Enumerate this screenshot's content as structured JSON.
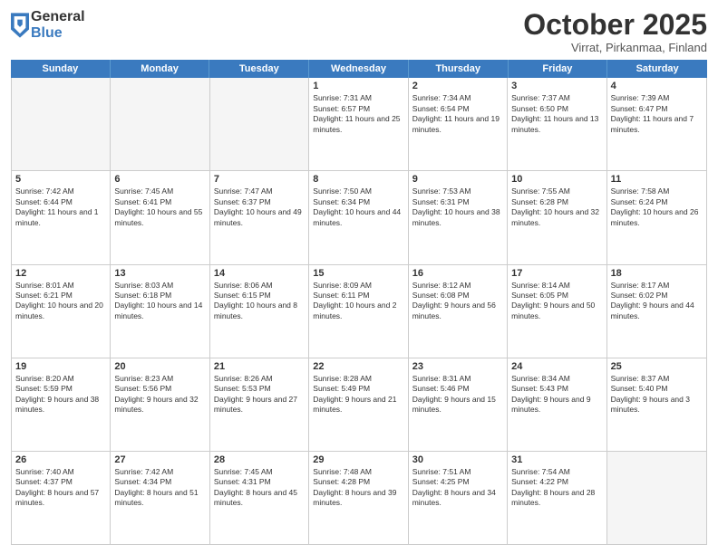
{
  "header": {
    "logo_general": "General",
    "logo_blue": "Blue",
    "month": "October 2025",
    "location": "Virrat, Pirkanmaa, Finland"
  },
  "days_of_week": [
    "Sunday",
    "Monday",
    "Tuesday",
    "Wednesday",
    "Thursday",
    "Friday",
    "Saturday"
  ],
  "weeks": [
    [
      {
        "day": "",
        "empty": true
      },
      {
        "day": "",
        "empty": true
      },
      {
        "day": "",
        "empty": true
      },
      {
        "day": "1",
        "sunrise": "7:31 AM",
        "sunset": "6:57 PM",
        "daylight": "11 hours and 25 minutes."
      },
      {
        "day": "2",
        "sunrise": "7:34 AM",
        "sunset": "6:54 PM",
        "daylight": "11 hours and 19 minutes."
      },
      {
        "day": "3",
        "sunrise": "7:37 AM",
        "sunset": "6:50 PM",
        "daylight": "11 hours and 13 minutes."
      },
      {
        "day": "4",
        "sunrise": "7:39 AM",
        "sunset": "6:47 PM",
        "daylight": "11 hours and 7 minutes."
      }
    ],
    [
      {
        "day": "5",
        "sunrise": "7:42 AM",
        "sunset": "6:44 PM",
        "daylight": "11 hours and 1 minute."
      },
      {
        "day": "6",
        "sunrise": "7:45 AM",
        "sunset": "6:41 PM",
        "daylight": "10 hours and 55 minutes."
      },
      {
        "day": "7",
        "sunrise": "7:47 AM",
        "sunset": "6:37 PM",
        "daylight": "10 hours and 49 minutes."
      },
      {
        "day": "8",
        "sunrise": "7:50 AM",
        "sunset": "6:34 PM",
        "daylight": "10 hours and 44 minutes."
      },
      {
        "day": "9",
        "sunrise": "7:53 AM",
        "sunset": "6:31 PM",
        "daylight": "10 hours and 38 minutes."
      },
      {
        "day": "10",
        "sunrise": "7:55 AM",
        "sunset": "6:28 PM",
        "daylight": "10 hours and 32 minutes."
      },
      {
        "day": "11",
        "sunrise": "7:58 AM",
        "sunset": "6:24 PM",
        "daylight": "10 hours and 26 minutes."
      }
    ],
    [
      {
        "day": "12",
        "sunrise": "8:01 AM",
        "sunset": "6:21 PM",
        "daylight": "10 hours and 20 minutes."
      },
      {
        "day": "13",
        "sunrise": "8:03 AM",
        "sunset": "6:18 PM",
        "daylight": "10 hours and 14 minutes."
      },
      {
        "day": "14",
        "sunrise": "8:06 AM",
        "sunset": "6:15 PM",
        "daylight": "10 hours and 8 minutes."
      },
      {
        "day": "15",
        "sunrise": "8:09 AM",
        "sunset": "6:11 PM",
        "daylight": "10 hours and 2 minutes."
      },
      {
        "day": "16",
        "sunrise": "8:12 AM",
        "sunset": "6:08 PM",
        "daylight": "9 hours and 56 minutes."
      },
      {
        "day": "17",
        "sunrise": "8:14 AM",
        "sunset": "6:05 PM",
        "daylight": "9 hours and 50 minutes."
      },
      {
        "day": "18",
        "sunrise": "8:17 AM",
        "sunset": "6:02 PM",
        "daylight": "9 hours and 44 minutes."
      }
    ],
    [
      {
        "day": "19",
        "sunrise": "8:20 AM",
        "sunset": "5:59 PM",
        "daylight": "9 hours and 38 minutes."
      },
      {
        "day": "20",
        "sunrise": "8:23 AM",
        "sunset": "5:56 PM",
        "daylight": "9 hours and 32 minutes."
      },
      {
        "day": "21",
        "sunrise": "8:26 AM",
        "sunset": "5:53 PM",
        "daylight": "9 hours and 27 minutes."
      },
      {
        "day": "22",
        "sunrise": "8:28 AM",
        "sunset": "5:49 PM",
        "daylight": "9 hours and 21 minutes."
      },
      {
        "day": "23",
        "sunrise": "8:31 AM",
        "sunset": "5:46 PM",
        "daylight": "9 hours and 15 minutes."
      },
      {
        "day": "24",
        "sunrise": "8:34 AM",
        "sunset": "5:43 PM",
        "daylight": "9 hours and 9 minutes."
      },
      {
        "day": "25",
        "sunrise": "8:37 AM",
        "sunset": "5:40 PM",
        "daylight": "9 hours and 3 minutes."
      }
    ],
    [
      {
        "day": "26",
        "sunrise": "7:40 AM",
        "sunset": "4:37 PM",
        "daylight": "8 hours and 57 minutes."
      },
      {
        "day": "27",
        "sunrise": "7:42 AM",
        "sunset": "4:34 PM",
        "daylight": "8 hours and 51 minutes."
      },
      {
        "day": "28",
        "sunrise": "7:45 AM",
        "sunset": "4:31 PM",
        "daylight": "8 hours and 45 minutes."
      },
      {
        "day": "29",
        "sunrise": "7:48 AM",
        "sunset": "4:28 PM",
        "daylight": "8 hours and 39 minutes."
      },
      {
        "day": "30",
        "sunrise": "7:51 AM",
        "sunset": "4:25 PM",
        "daylight": "8 hours and 34 minutes."
      },
      {
        "day": "31",
        "sunrise": "7:54 AM",
        "sunset": "4:22 PM",
        "daylight": "8 hours and 28 minutes."
      },
      {
        "day": "",
        "empty": true
      }
    ]
  ]
}
